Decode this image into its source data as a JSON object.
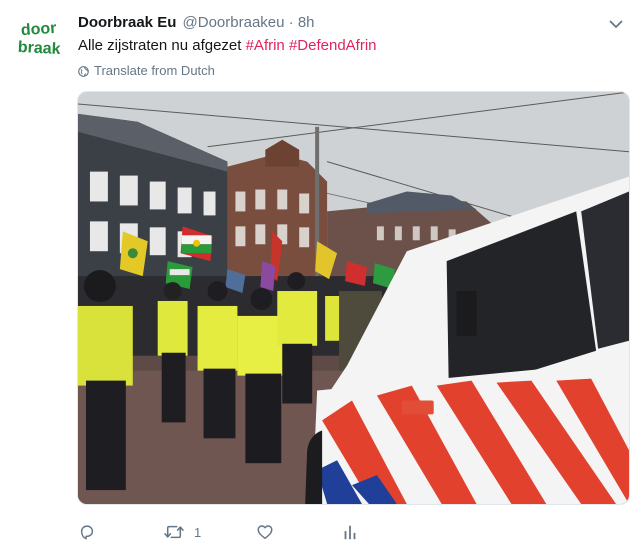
{
  "tweet": {
    "author_name": "Doorbraak Eu",
    "handle": "@Doorbraakeu",
    "separator": "·",
    "time": "8h",
    "text_plain": "Alle zijstraten nu afgezet ",
    "hashtags": [
      "#Afrin",
      "#DefendAfrin"
    ],
    "translate_label": "Translate from Dutch",
    "media_alt": "",
    "colors": {
      "hashtag": "#e0245e",
      "secondary": "#657786",
      "logo_green": "#1f8a3b"
    }
  },
  "avatar": {
    "logo_line1": "door",
    "logo_line2": "braak"
  },
  "actions": {
    "reply_count": "",
    "retweet_count": "1",
    "like_count": "",
    "icons": [
      "reply-icon",
      "retweet-icon",
      "like-icon",
      "analytics-icon"
    ]
  }
}
